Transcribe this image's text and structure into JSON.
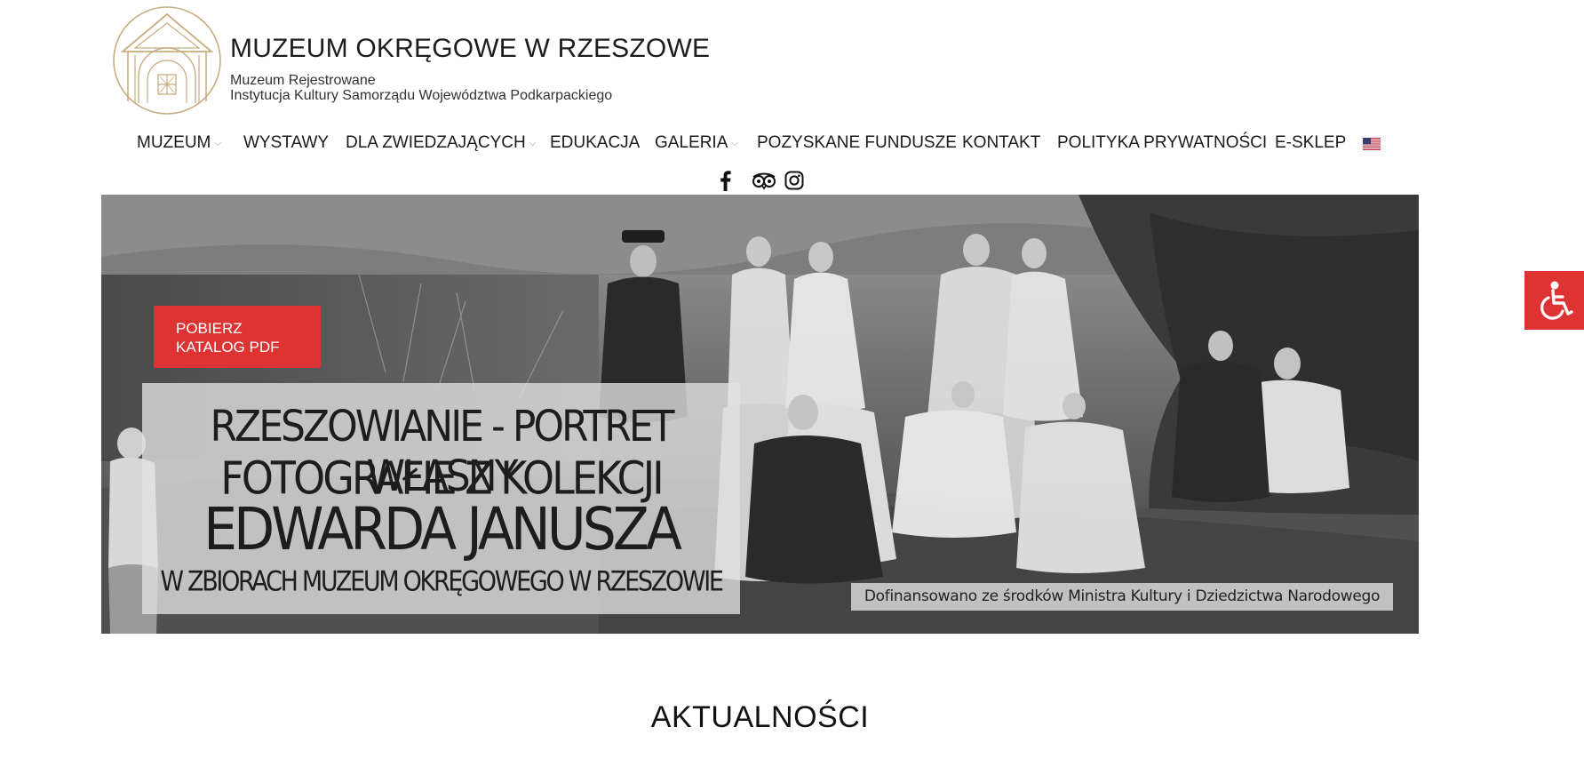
{
  "header": {
    "title": "MUZEUM OKRĘGOWE W RZESZOWE",
    "subtitle_line1": "Muzeum Rejestrowane",
    "subtitle_line2": "Instytucja Kultury Samorządu Województwa Podkarpackiego"
  },
  "nav": {
    "items": [
      {
        "label": "MUZEUM",
        "has_dropdown": true
      },
      {
        "label": "WYSTAWY",
        "has_dropdown": false
      },
      {
        "label": "DLA ZWIEDZAJĄCYCH",
        "has_dropdown": true
      },
      {
        "label": "EDUKACJA",
        "has_dropdown": false
      },
      {
        "label": "GALERIA",
        "has_dropdown": true
      },
      {
        "label": "POZYSKANE FUNDUSZE",
        "has_dropdown": false
      },
      {
        "label": "KONTAKT",
        "has_dropdown": false
      },
      {
        "label": "POLITYKA PRYWATNOŚCI",
        "has_dropdown": false
      },
      {
        "label": "E-SKLEP",
        "has_dropdown": false
      }
    ],
    "language_flag_icon": "us-flag-icon",
    "chevron_glyph": "⌵"
  },
  "social": {
    "icons": [
      "facebook-icon",
      "tripadvisor-icon",
      "instagram-icon"
    ]
  },
  "hero": {
    "pdf_button_line1": "POBIERZ",
    "pdf_button_line2": "KATALOG PDF",
    "title_line1": "RZESZOWIANIE - PORTRET WŁASNY",
    "title_line2": "FOTOGRAFIE Z KOLEKCJI",
    "title_line3": "EDWARDA JANUSZA",
    "title_line4": "W ZBIORACH MUZEUM OKRĘGOWEGO W RZESZOWIE",
    "cofinance_text": "Dofinansowano ze środków Ministra Kultury i Dziedzictwa Narodowego"
  },
  "accessibility": {
    "icon": "wheelchair-icon"
  },
  "main": {
    "section_title": "AKTUALNOŚCI"
  },
  "colors": {
    "accent": "#dd3333",
    "logo_gold": "#c8ad7f",
    "text": "#1a1a1a"
  }
}
